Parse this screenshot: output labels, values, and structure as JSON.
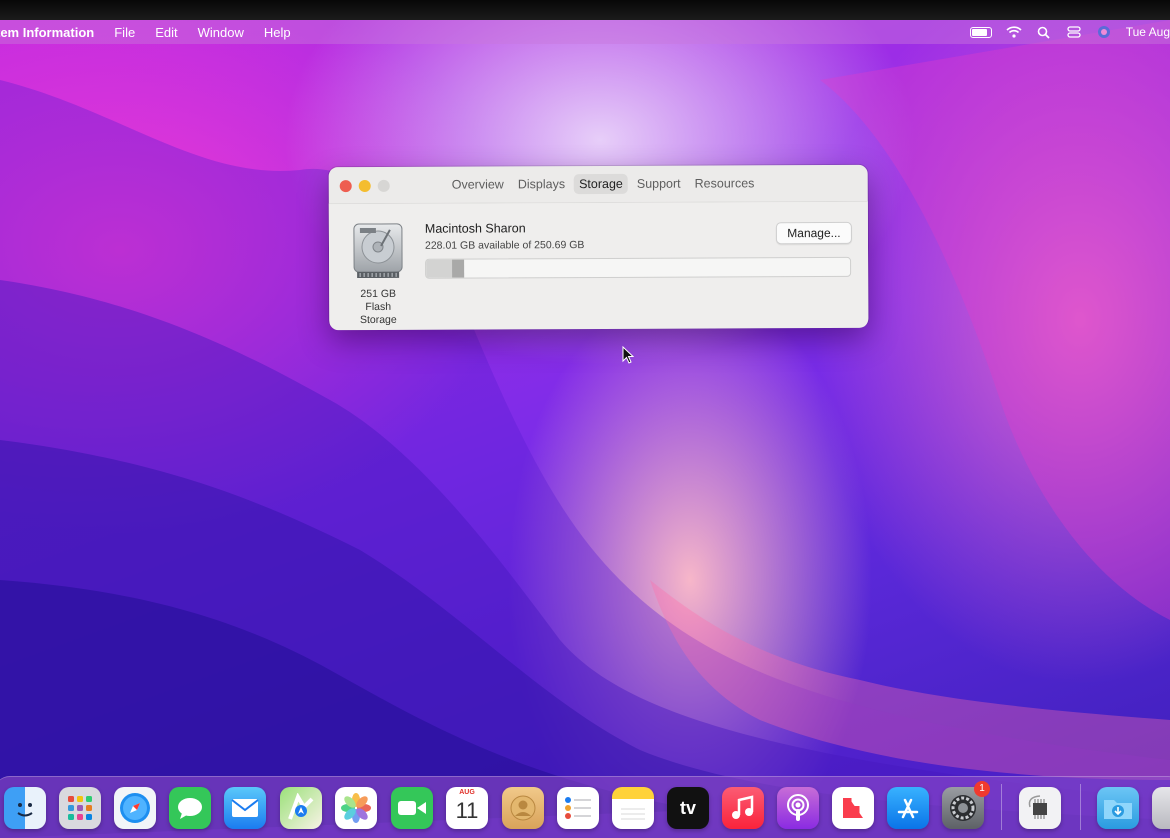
{
  "menubar": {
    "app_name": "tem Information",
    "menus": [
      "File",
      "Edit",
      "Window",
      "Help"
    ],
    "clock": "Tue Aug"
  },
  "window": {
    "tabs": [
      "Overview",
      "Displays",
      "Storage",
      "Support",
      "Resources"
    ],
    "active_tab": "Storage",
    "disk": {
      "name": "Macintosh Sharon",
      "availability": "228.01 GB available of 250.69 GB",
      "capacity_label": "251 GB",
      "type_label": "Flash Storage",
      "used_fraction": 0.09
    },
    "manage_button": "Manage..."
  },
  "dock": {
    "calendar_month": "AUG",
    "calendar_day": "11",
    "tv_label": "tv",
    "settings_badge": "1"
  },
  "colors": {
    "close": "#ee5d50",
    "minimize": "#f4bd2f",
    "accent_badge": "#f03a2e"
  }
}
